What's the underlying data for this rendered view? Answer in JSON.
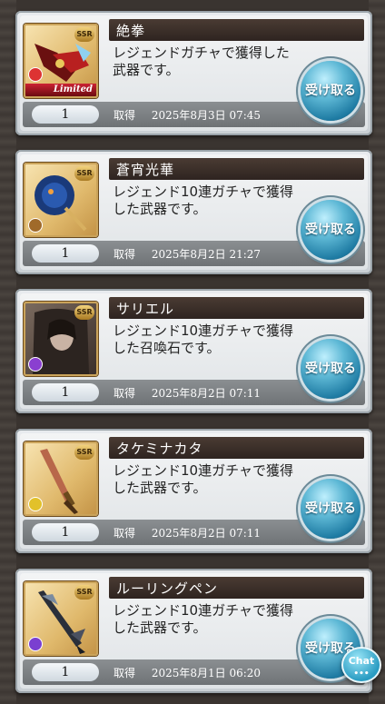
{
  "items": [
    {
      "name": "絶拳",
      "description": "レジェンドガチャで獲得した武器です。",
      "quantity": "1",
      "acquired_label": "取得",
      "date": "2025年8月3日 07:45",
      "receive_label": "受け取る",
      "rarity": "SSR",
      "limited_label": "Limited",
      "element_color": "#d33"
    },
    {
      "name": "蒼宵光華",
      "description": "レジェンド10連ガチャで獲得した武器です。",
      "quantity": "1",
      "acquired_label": "取得",
      "date": "2025年8月2日 21:27",
      "receive_label": "受け取る",
      "rarity": "SSR",
      "element_color": "#a06a2a"
    },
    {
      "name": "サリエル",
      "description": "レジェンド10連ガチャで獲得した召喚石です。",
      "quantity": "1",
      "acquired_label": "取得",
      "date": "2025年8月2日 07:11",
      "receive_label": "受け取る",
      "rarity": "SSR",
      "element_color": "#8a3fd0"
    },
    {
      "name": "タケミナカタ",
      "description": "レジェンド10連ガチャで獲得した武器です。",
      "quantity": "1",
      "acquired_label": "取得",
      "date": "2025年8月2日 07:11",
      "receive_label": "受け取る",
      "rarity": "SSR",
      "element_color": "#e2c12a"
    },
    {
      "name": "ルーリングペン",
      "description": "レジェンド10連ガチャで獲得した武器です。",
      "quantity": "1",
      "acquired_label": "取得",
      "date": "2025年8月1日 06:20",
      "receive_label": "受け取る",
      "rarity": "SSR",
      "element_color": "#7a3fd0"
    }
  ],
  "chat_label": "Chat",
  "chat_dots": "•••"
}
